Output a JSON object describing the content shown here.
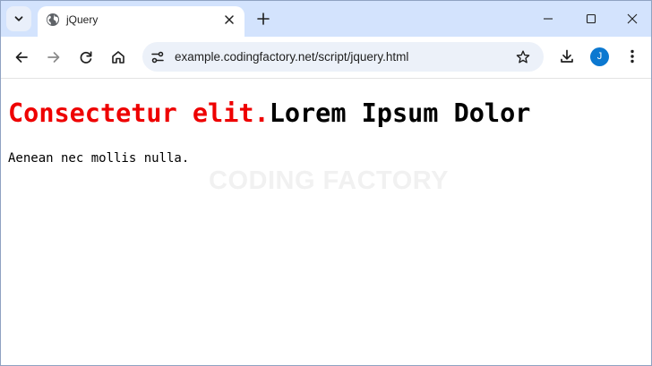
{
  "browser": {
    "tab": {
      "title": "jQuery"
    },
    "address_bar": {
      "url": "example.codingfactory.net/script/jquery.html"
    },
    "profile": {
      "initial": "J",
      "color": "#0b78d0"
    },
    "colors": {
      "tabstrip": "#d3e3fd",
      "omnibox": "#ecf1f9"
    }
  },
  "page": {
    "heading_accent": "Consectetur elit.",
    "heading_rest": "Lorem Ipsum Dolor",
    "paragraph": "Aenean nec mollis nulla.",
    "watermark": "CODING FACTORY",
    "accent_color": "#ee0000"
  },
  "icons": [
    "chevron-down-icon",
    "globe-icon",
    "close-icon",
    "plus-icon",
    "minimize-icon",
    "maximize-icon",
    "back-arrow-icon",
    "forward-arrow-icon",
    "reload-icon",
    "home-icon",
    "site-info-icon",
    "star-icon",
    "download-icon",
    "more-vert-icon"
  ]
}
